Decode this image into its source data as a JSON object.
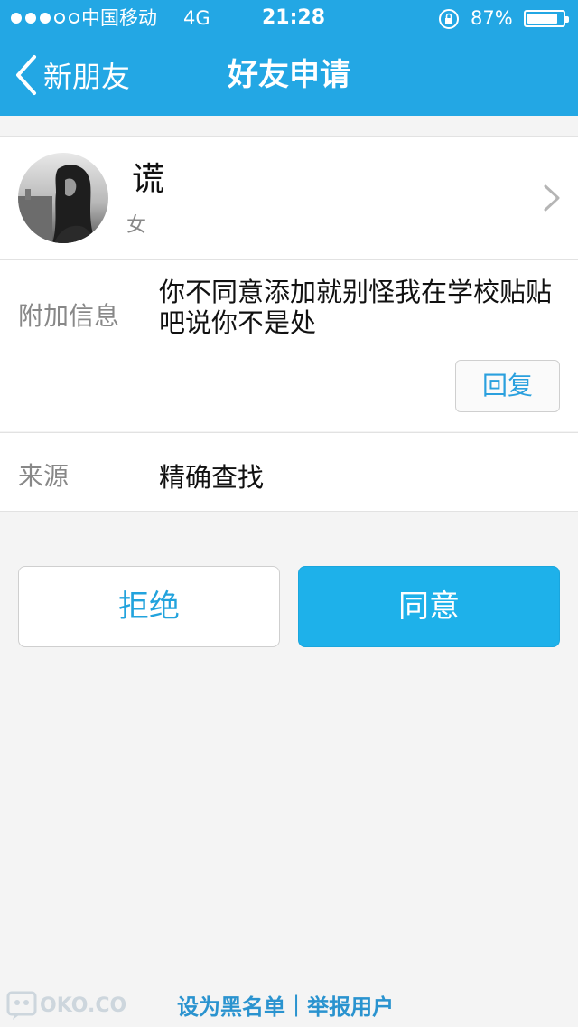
{
  "status_bar": {
    "carrier": "中国移动",
    "network": "4G",
    "time": "21:28",
    "battery": "87%",
    "battery_level": 0.87,
    "signal_bars": 3,
    "signal_total": 5,
    "icons": [
      "signal-dots-icon",
      "rotation-lock-icon",
      "battery-icon"
    ]
  },
  "nav": {
    "back_label": "新朋友",
    "title": "好友申请",
    "back_icon": "chevron-left-icon"
  },
  "profile": {
    "nickname": "谎",
    "gender": "女",
    "chevron_icon": "chevron-right-icon"
  },
  "message": {
    "label": "附加信息",
    "text": "你不同意添加就别怪我在学校贴贴吧说你不是处",
    "reply_label": "回复"
  },
  "source": {
    "label": "来源",
    "value": "精确查找"
  },
  "actions": {
    "reject_label": "拒绝",
    "accept_label": "同意"
  },
  "footer": {
    "blacklist_label": "设为黑名单",
    "separator": "|",
    "report_label": "举报用户"
  },
  "watermark": {
    "text": "OKO.CO"
  },
  "colors": {
    "header": "#23a7e4",
    "accent": "#1eb1ea",
    "link": "#2a93cf",
    "background": "#f4f4f4"
  }
}
